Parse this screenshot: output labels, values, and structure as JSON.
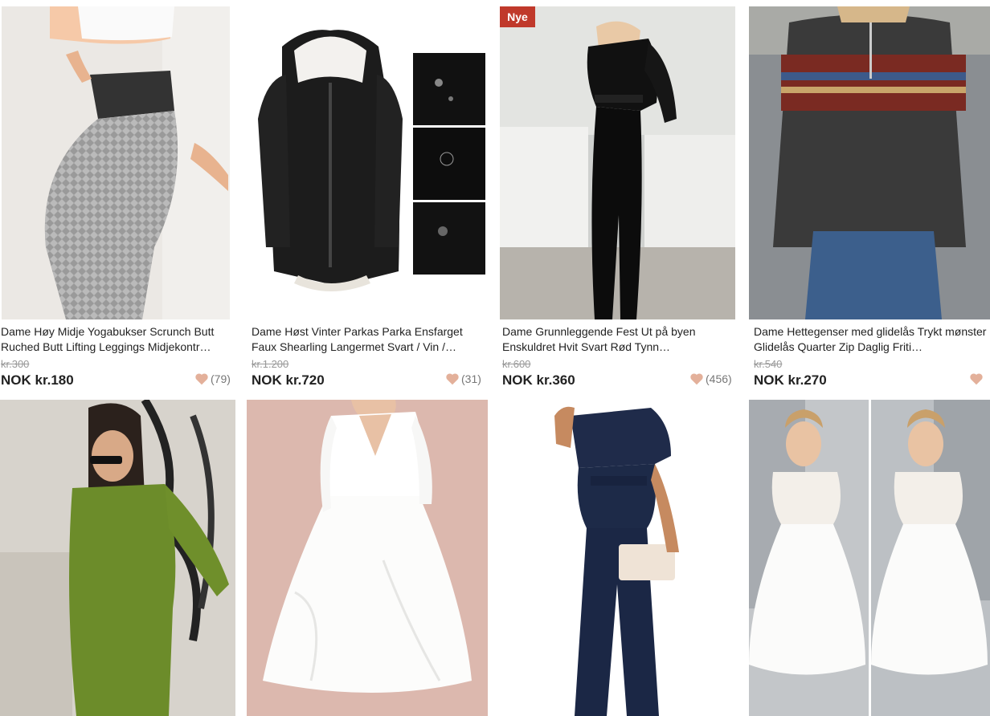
{
  "accent": "#c0392b",
  "heart_color": "#e3b09a",
  "products": [
    {
      "title": "Dame Høy Midje Yogabukser Scrunch Butt Ruched Butt Lifting Leggings Midjekontr…",
      "old_price": "kr.300",
      "price": "NOK kr.180",
      "reviews": "(79)",
      "image": "leggings-photo"
    },
    {
      "title": "Dame Høst Vinter Parkas Parka Ensfarget Faux Shearling Langermet Svart / Vin /…",
      "old_price": "kr.1.200",
      "price": "NOK kr.720",
      "reviews": "(31)",
      "image": "parka-photo"
    },
    {
      "title": "Dame Grunnleggende Fest Ut på byen Enskuldret Hvit Svart Rød Tynn…",
      "old_price": "kr.600",
      "price": "NOK kr.360",
      "reviews": "(456)",
      "image": "jumpsuit-black-photo",
      "badge": "Nye"
    },
    {
      "title": "Dame Hettegenser med glidelås Trykt mønster Glidelås Quarter Zip Daglig Friti…",
      "old_price": "kr.540",
      "price": "NOK kr.270",
      "reviews": "",
      "image": "sweater-photo"
    }
  ],
  "row2": [
    {
      "image": "green-dress-photo"
    },
    {
      "image": "white-dress-photo"
    },
    {
      "image": "navy-jumpsuit-photo"
    },
    {
      "image": "wedding-dress-photo"
    }
  ]
}
